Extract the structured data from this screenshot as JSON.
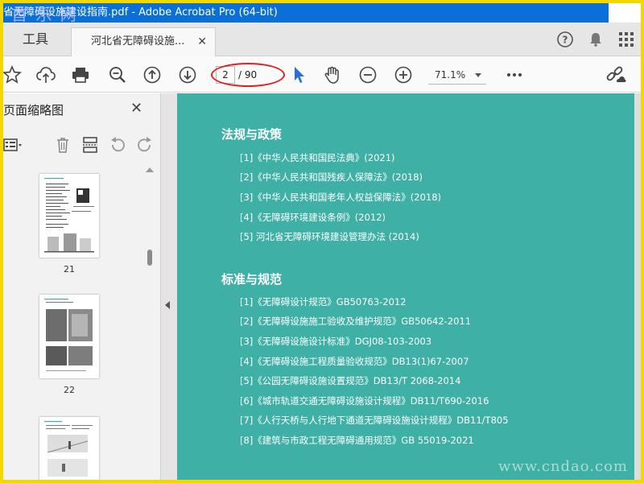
{
  "window": {
    "title": "省无障碍设施建设指南.pdf - Adobe Acrobat Pro (64-bit)",
    "watermark_top": "首 乐 网",
    "watermark_bottom": "www.cndao.com"
  },
  "tabs": {
    "tools_label": "工具",
    "doc_tab_label": "河北省无障碍设施..."
  },
  "toolbar": {
    "current_page": "2",
    "total_pages": "/ 90",
    "zoom": "71.1%"
  },
  "sidebar": {
    "title": "页面缩略图",
    "thumbnails": [
      {
        "label": "21"
      },
      {
        "label": "22"
      }
    ]
  },
  "document": {
    "sections": [
      {
        "title": "法规与政策",
        "items": [
          "[1]《中华人民共和国民法典》(2021)",
          "[2]《中华人民共和国残疾人保障法》(2018)",
          "[3]《中华人民共和国老年人权益保障法》(2018)",
          "[4]《无障碍环境建设条例》(2012)",
          "[5] 河北省无障碍环境建设管理办法 (2014)"
        ]
      },
      {
        "title": "标准与规范",
        "items": [
          "[1]《无障碍设计规范》GB50763-2012",
          "[2]《无障碍设施施工验收及维护规范》GB50642-2011",
          "[3]《无障碍设施设计标准》DGJ08-103-2003",
          "[4]《无障碍设施工程质量验收规范》DB13(1)67-2007",
          "[5]《公园无障碍设施设置规范》DB13/T 2068-2014",
          "[6]《城市轨道交通无障碍设施设计规程》DB11/T690-2016",
          "[7]《人行天桥与人行地下通道无障碍设施设计规程》DB11/T805",
          "[8]《建筑与市政工程无障碍通用规范》GB 55019-2021"
        ]
      }
    ]
  },
  "colors": {
    "titlebar": "#0a6fd6",
    "page_bg": "#3eb0a6",
    "highlight_oval": "#e02020",
    "frame": "#f0d800"
  }
}
